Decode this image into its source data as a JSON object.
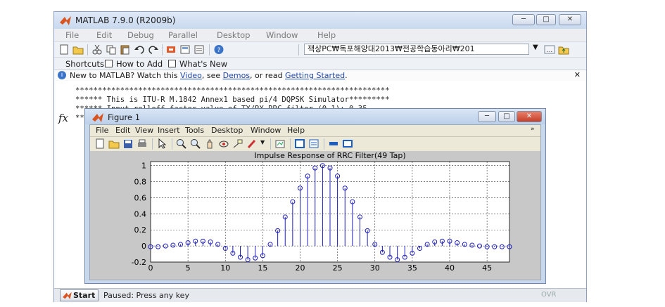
{
  "main_window": {
    "title": "MATLAB  7.9.0 (R2009b)",
    "menu": [
      "File",
      "Edit",
      "Debug",
      "Parallel",
      "Desktop",
      "Window",
      "Help"
    ],
    "current_folder": "잭상PC₩독포해양대2013₩전공학습동아리₩201",
    "shortcuts": {
      "label": "Shortcuts",
      "items": [
        "How to Add",
        "What's New"
      ]
    },
    "info_bar": {
      "prefix": "New to MATLAB? Watch this ",
      "video_link": "Video",
      "mid1": ", see ",
      "demos_link": "Demos",
      "mid2": ", or read ",
      "started_link": "Getting Started",
      "suffix": "."
    },
    "command_lines": [
      "**********************************************************************",
      "****** This is ITU-R M.1842 Annex1 based pi/4 DQPSK Simulator*********",
      "****** Input rolloff factor value of TX/RX RRC filter (0~1): 0.35",
      "**********************************************************************"
    ],
    "fx_label": "fx",
    "status": {
      "start": "Start",
      "text": "Paused: Press any key",
      "ovr": "OVR"
    }
  },
  "figure": {
    "title": "Figure 1",
    "menu": [
      "File",
      "Edit",
      "View",
      "Insert",
      "Tools",
      "Desktop",
      "Window",
      "Help"
    ]
  },
  "chart_data": {
    "type": "stem",
    "title": "Impulse Response of RRC Filter(49 Tap)",
    "x": [
      0,
      1,
      2,
      3,
      4,
      5,
      6,
      7,
      8,
      9,
      10,
      11,
      12,
      13,
      14,
      15,
      16,
      17,
      18,
      19,
      20,
      21,
      22,
      23,
      24,
      25,
      26,
      27,
      28,
      29,
      30,
      31,
      32,
      33,
      34,
      35,
      36,
      37,
      38,
      39,
      40,
      41,
      42,
      43,
      44,
      45,
      46,
      47,
      48
    ],
    "values": [
      -0.01,
      -0.01,
      0.0,
      0.01,
      0.02,
      0.04,
      0.06,
      0.06,
      0.05,
      0.02,
      -0.03,
      -0.09,
      -0.14,
      -0.17,
      -0.15,
      -0.12,
      0.02,
      0.19,
      0.36,
      0.55,
      0.72,
      0.87,
      0.97,
      1.0,
      0.97,
      0.87,
      0.72,
      0.55,
      0.36,
      0.19,
      0.02,
      -0.08,
      -0.14,
      -0.17,
      -0.14,
      -0.09,
      -0.03,
      0.02,
      0.05,
      0.06,
      0.06,
      0.04,
      0.02,
      0.01,
      0.0,
      -0.01,
      -0.01,
      -0.01,
      -0.01
    ],
    "xticks": [
      0,
      5,
      10,
      15,
      20,
      25,
      30,
      35,
      40,
      45
    ],
    "yticks": [
      -0.2,
      0,
      0.2,
      0.4,
      0.6,
      0.8,
      1
    ],
    "ytick_labels": [
      "-0.2",
      "0",
      "0.2",
      "0.4",
      "0.6",
      "0.8",
      "1"
    ],
    "xlim": [
      0,
      48
    ],
    "ylim": [
      -0.2,
      1.05
    ],
    "grid": true,
    "color": "#1d1dbd"
  }
}
